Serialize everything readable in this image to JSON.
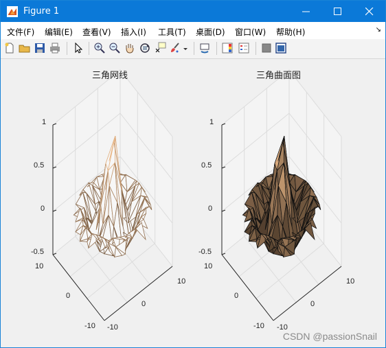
{
  "window": {
    "title": "Figure 1",
    "icons": {
      "app": "matlab-figure-icon",
      "minimize": "minimize-icon",
      "maximize": "maximize-icon",
      "close": "close-icon"
    }
  },
  "menu": {
    "items": [
      "文件(F)",
      "编辑(E)",
      "查看(V)",
      "插入(I)",
      "工具(T)",
      "桌面(D)",
      "窗口(W)",
      "帮助(H)"
    ],
    "overflow_icon": "menu-dock-arrow-icon"
  },
  "toolbar": {
    "buttons": [
      "new-figure-icon",
      "open-file-icon",
      "save-icon",
      "print-icon",
      "edit-plot-arrow-icon",
      "zoom-in-icon",
      "zoom-out-icon",
      "pan-hand-icon",
      "rotate-3d-icon",
      "data-cursor-icon",
      "brush-icon",
      "brush-dropdown-icon",
      "link-plot-icon",
      "colorbar-icon",
      "legend-icon",
      "hide-plot-tools-icon",
      "show-plot-tools-icon"
    ]
  },
  "plots": [
    {
      "title": "三角网线",
      "style": "mesh",
      "z_ticks": [
        "1",
        "0.5",
        "0",
        "-0.5"
      ],
      "y_ticks": [
        "10",
        "0",
        "-10"
      ],
      "x_ticks": [
        "10",
        "0",
        "-10"
      ]
    },
    {
      "title": "三角曲面图",
      "style": "surface",
      "z_ticks": [
        "1",
        "0.5",
        "0",
        "-0.5"
      ],
      "y_ticks": [
        "10",
        "0",
        "-10"
      ],
      "x_ticks": [
        "10",
        "0",
        "-10"
      ]
    }
  ],
  "colors": {
    "titlebar": "#0b79d8",
    "mesh_edge": "#9c7a66",
    "surface_face": "#8a6b58",
    "peak_light": "#f4dcc0",
    "background": "#f0f0f0"
  },
  "watermark": "CSDN @passionSnail"
}
